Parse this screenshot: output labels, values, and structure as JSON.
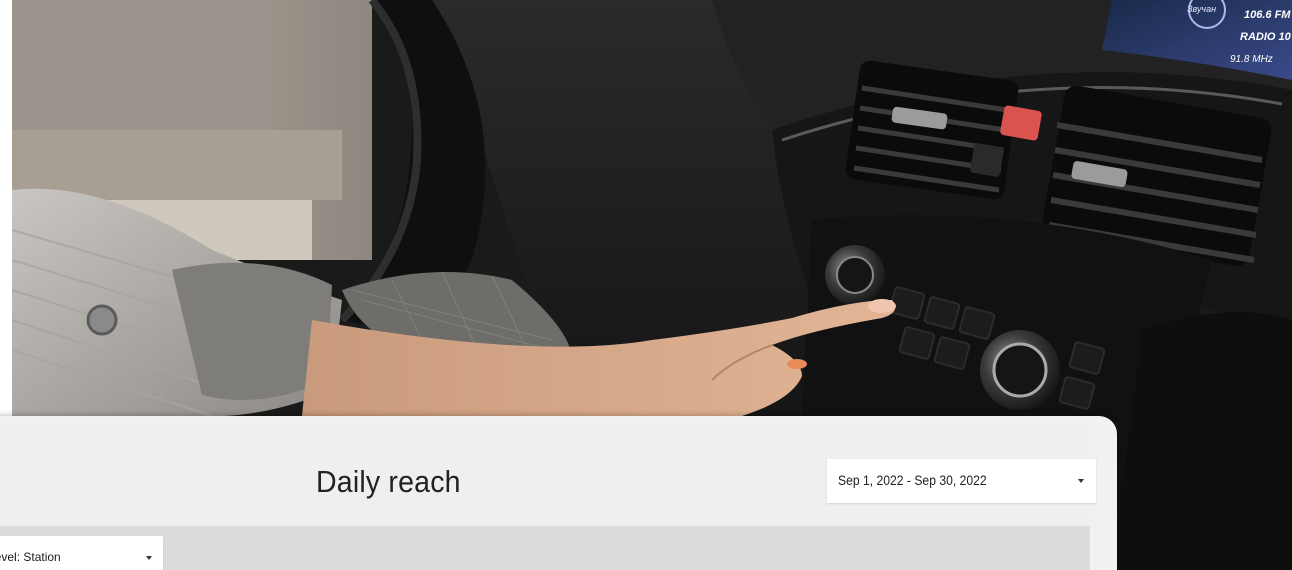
{
  "dashboard": {
    "title": "Daily reach",
    "date_range": "Sep 1, 2022 - Sep 30, 2022",
    "level_filter": {
      "label": "Level",
      "separator": ": ",
      "value": "Station"
    }
  },
  "photo": {
    "display_lines": [
      "Звучан",
      "106.6 FM",
      "RADIO 10",
      "91.8 MHz"
    ]
  },
  "colors": {
    "card_background": "#f1f1f1",
    "filter_bar": "#dcdcdc",
    "control_background": "#ffffff"
  },
  "icons": {
    "date_dropdown": "caret-down",
    "level_dropdown": "caret-down"
  }
}
